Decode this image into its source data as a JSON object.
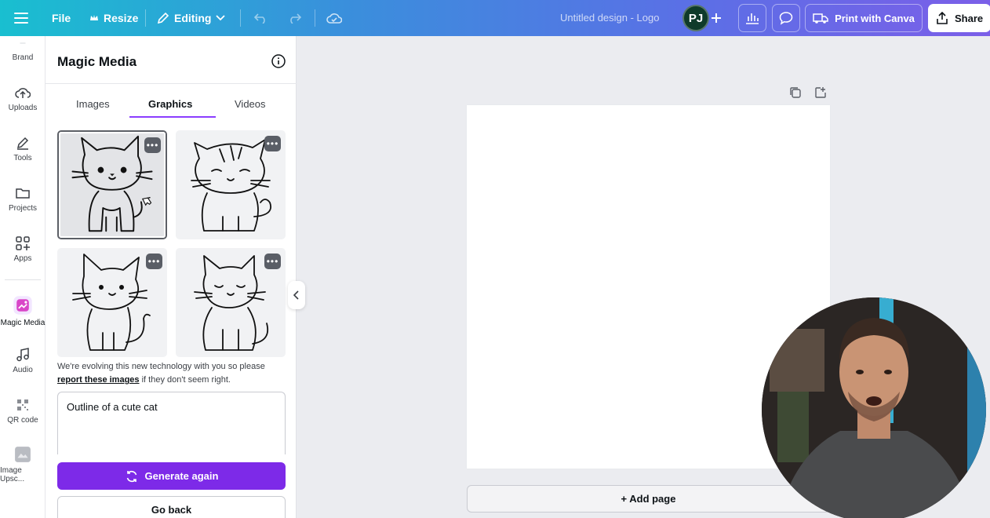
{
  "topbar": {
    "menu_icon": "hamburger-icon",
    "file_label": "File",
    "resize_label": "Resize",
    "editing_label": "Editing",
    "design_title": "Untitled design - Logo",
    "avatar_initials": "PJ",
    "print_label": "Print with Canva",
    "share_label": "Share"
  },
  "rail": {
    "items": [
      {
        "label": "Brand",
        "icon": "brand-icon"
      },
      {
        "label": "Uploads",
        "icon": "cloud-upload-icon"
      },
      {
        "label": "Tools",
        "icon": "pen-icon"
      },
      {
        "label": "Projects",
        "icon": "folder-icon"
      },
      {
        "label": "Apps",
        "icon": "apps-icon"
      },
      {
        "label": "Magic Media",
        "icon": "magic-media-icon"
      },
      {
        "label": "Audio",
        "icon": "music-note-icon"
      },
      {
        "label": "QR code",
        "icon": "qr-code-icon"
      },
      {
        "label": "Image Upsc...",
        "icon": "image-upscaler-icon"
      }
    ]
  },
  "panel": {
    "title": "Magic Media",
    "tabs": [
      "Images",
      "Graphics",
      "Videos"
    ],
    "active_tab": "Graphics",
    "disclaimer_text": "We're evolving this new technology with you so please",
    "disclaimer_link": "report these images",
    "disclaimer_tail": " if they don't seem right.",
    "prompt_value": "Outline of a cute cat",
    "generate_label": "Generate again",
    "back_label": "Go back",
    "more_glyph": "•••"
  },
  "canvas": {
    "add_page_label": "+ Add page"
  },
  "colors": {
    "accent": "#7d2ae8",
    "tab_underline": "#8b3dff",
    "topbar_start": "#19bfd0",
    "topbar_end": "#7b5fe8"
  }
}
